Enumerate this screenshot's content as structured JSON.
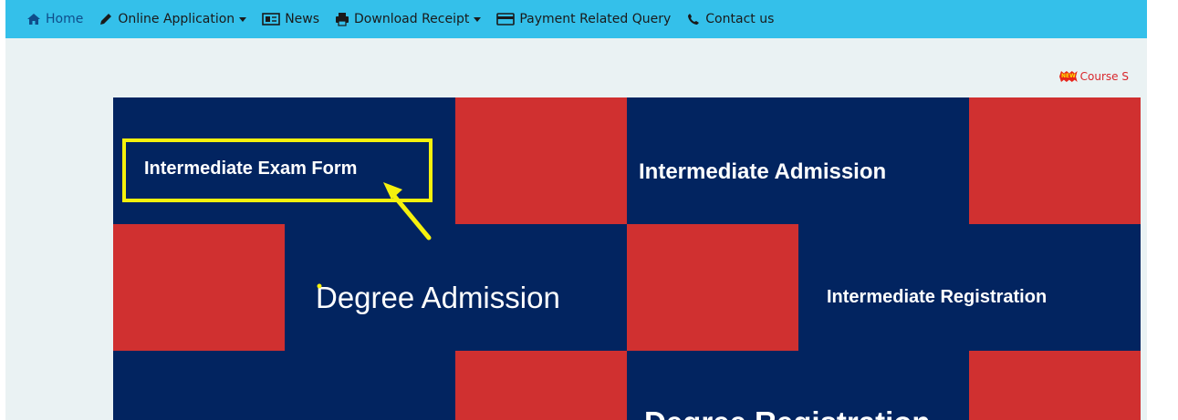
{
  "navbar": {
    "bg_color": "#34c0ea",
    "items": [
      {
        "label": "Home",
        "icon": "home-icon",
        "dropdown": false,
        "active": true
      },
      {
        "label": "Online Application",
        "icon": "pencil-icon",
        "dropdown": true
      },
      {
        "label": "News",
        "icon": "newspaper-icon",
        "dropdown": false
      },
      {
        "label": "Download Receipt",
        "icon": "print-icon",
        "dropdown": true
      },
      {
        "label": "Payment Related Query",
        "icon": "credit-card-icon",
        "dropdown": false
      },
      {
        "label": "Contact us",
        "icon": "phone-icon",
        "dropdown": false
      }
    ]
  },
  "marquee": {
    "badge": "NEW",
    "text": "Course S"
  },
  "banner": {
    "navy_color": "#022460",
    "red_color": "#d03030",
    "tiles": {
      "intermediate_exam_form": "Intermediate Exam Form",
      "intermediate_admission": "Intermediate Admission",
      "degree_admission": "Degree Admission",
      "intermediate_registration": "Intermediate Registration",
      "degree_registration": "Degree Registration"
    }
  },
  "annotation": {
    "highlight_color": "#f5f10d"
  }
}
